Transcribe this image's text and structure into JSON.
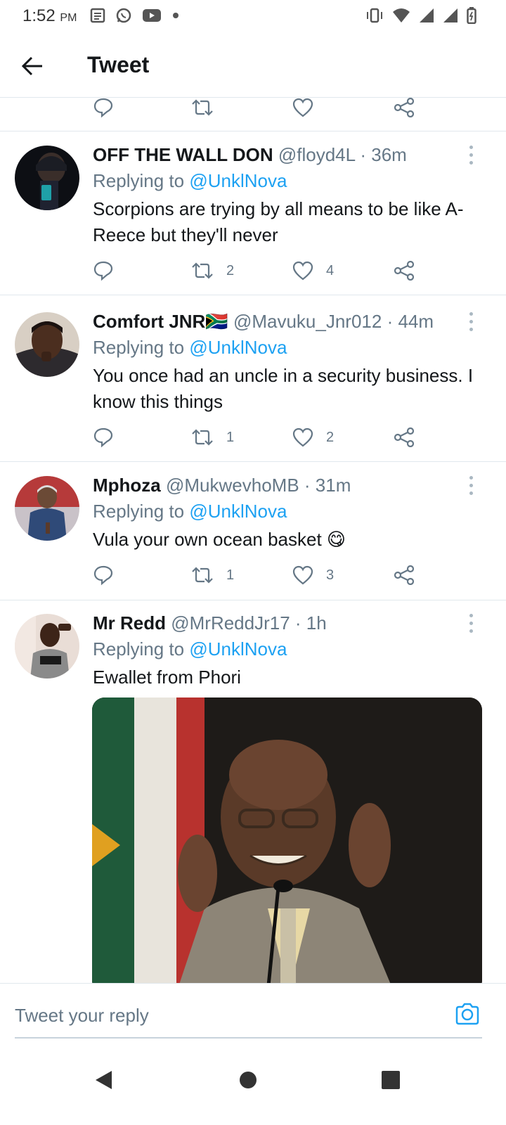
{
  "status_bar": {
    "time": "1:52",
    "ampm": "PM",
    "left_icons": [
      "news-icon",
      "whatsapp-icon",
      "youtube-icon",
      "dot-icon"
    ],
    "right_icons": [
      "vibrate-icon",
      "wifi-icon",
      "signal-icon",
      "signal-icon",
      "battery-icon"
    ]
  },
  "header": {
    "back_icon": "arrow-left-icon",
    "title": "Tweet"
  },
  "colors": {
    "accent": "#1da1f2",
    "text_primary": "#14171a",
    "text_secondary": "#657786",
    "divider": "#e1e8ed"
  },
  "tweets": [
    {
      "name": "OFF THE WALL DON",
      "handle": "@floyd4L",
      "time": "36m",
      "replying_label": "Replying to",
      "replying_to": "@UnklNova",
      "text": "Scorpions are trying by all means to be like A-Reece but they'll never",
      "retweets": "2",
      "likes": "4"
    },
    {
      "name": "Comfort JNR",
      "flag": "🇿🇦",
      "handle": "@Mavuku_Jnr012",
      "time": "44m",
      "replying_label": "Replying to",
      "replying_to": "@UnklNova",
      "text": "You once had an uncle in a security business. I know this things",
      "retweets": "1",
      "likes": "2"
    },
    {
      "name": "Mphoza",
      "handle": "@MukwevhoMB",
      "time": "31m",
      "replying_label": "Replying to",
      "replying_to": "@UnklNova",
      "text": "Vula your own ocean basket 😋",
      "retweets": "1",
      "likes": "3"
    },
    {
      "name": "Mr Redd",
      "handle": "@MrReddJr17",
      "time": "1h",
      "replying_label": "Replying to",
      "replying_to": "@UnklNova",
      "text": "Ewallet from Phori"
    }
  ],
  "composer": {
    "placeholder": "Tweet your reply",
    "camera_icon": "camera-icon"
  },
  "nav": {
    "icons": [
      "back-triangle-icon",
      "home-circle-icon",
      "recents-square-icon"
    ]
  }
}
